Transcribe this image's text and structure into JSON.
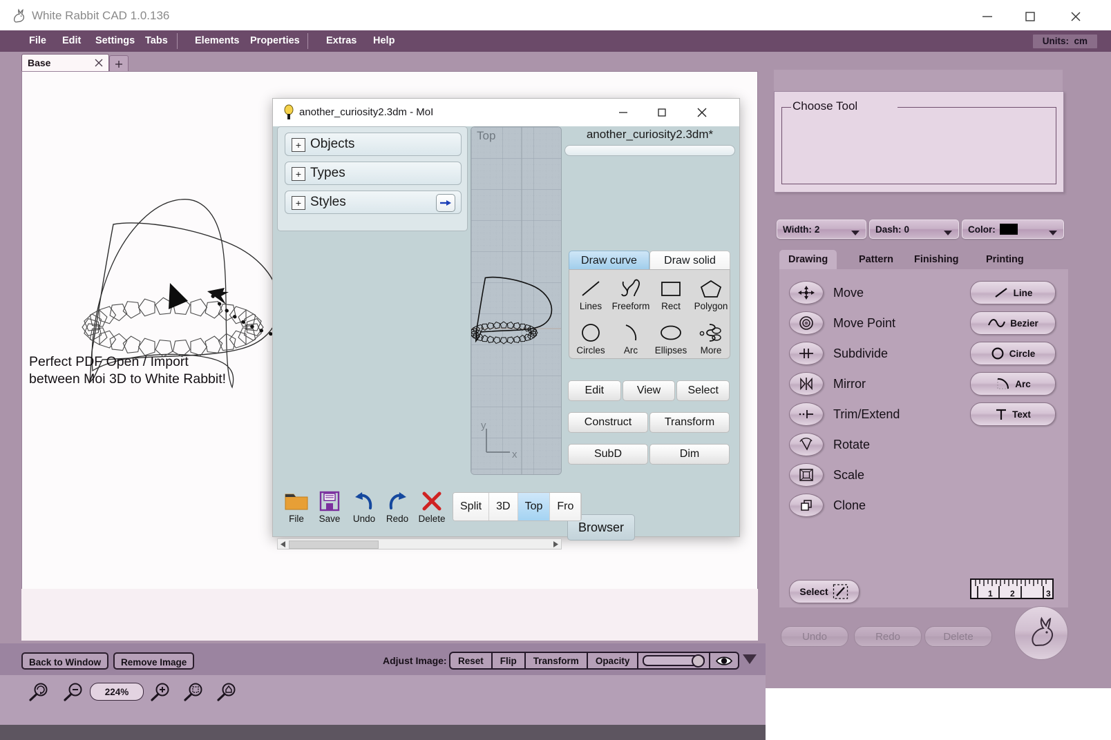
{
  "window": {
    "title": "White Rabbit CAD 1.0.136",
    "icon": "rabbit-icon",
    "minimize": "minimize-icon",
    "maximize": "maximize-icon",
    "close": "close-icon"
  },
  "menu": {
    "items": [
      "File",
      "Edit",
      "Settings",
      "Tabs",
      "Elements",
      "Properties",
      "Extras",
      "Help"
    ],
    "units_label": "Units:",
    "units_value": "cm"
  },
  "tabs": {
    "documents": [
      {
        "label": "Base",
        "close": "close-icon"
      }
    ],
    "add_label": "+"
  },
  "canvas": {
    "note_line1": "Perfect PDF Open / Import",
    "note_line2": "between Moi 3D to White Rabbit!"
  },
  "adjust_bar": {
    "back_to_window": "Back to Window",
    "remove_image": "Remove Image",
    "label": "Adjust Image:",
    "buttons": [
      "Reset",
      "Flip",
      "Transform",
      "Opacity"
    ],
    "opacity_value": 100,
    "eye_icon": "eye-icon",
    "expander_icon": "triangle-down-icon"
  },
  "zoom_bar": {
    "zoom_value": "224%",
    "icons": [
      "zoom-reset-icon",
      "zoom-out-icon",
      "zoom-in-icon",
      "zoom-to-selection-icon",
      "zoom-to-fit-icon"
    ]
  },
  "sidebar": {
    "choose_tool_legend": "Choose Tool",
    "controls": [
      {
        "name": "width",
        "label": "Width:",
        "value": "2"
      },
      {
        "name": "dash",
        "label": "Dash:",
        "value": "0"
      },
      {
        "name": "color",
        "label": "Color:",
        "value": "",
        "swatch": "#000000"
      }
    ],
    "tabs": [
      "Drawing",
      "Pattern",
      "Finishing",
      "Printing"
    ],
    "active_tab": "Drawing",
    "tools": [
      {
        "label": "Move",
        "icon": "move-icon"
      },
      {
        "label": "Move Point",
        "icon": "move-point-icon"
      },
      {
        "label": "Subdivide",
        "icon": "subdivide-icon"
      },
      {
        "label": "Mirror",
        "icon": "mirror-icon"
      },
      {
        "label": "Trim/Extend",
        "icon": "trim-extend-icon"
      },
      {
        "label": "Rotate",
        "icon": "rotate-icon"
      },
      {
        "label": "Scale",
        "icon": "scale-icon"
      },
      {
        "label": "Clone",
        "icon": "clone-icon"
      }
    ],
    "shapes": [
      {
        "label": "Line",
        "icon": "line-icon"
      },
      {
        "label": "Bezier",
        "icon": "bezier-icon"
      },
      {
        "label": "Circle",
        "icon": "circle-icon"
      },
      {
        "label": "Arc",
        "icon": "arc-icon"
      },
      {
        "label": "Text",
        "icon": "text-icon"
      }
    ],
    "select_label": "Select",
    "ruler_ticks": [
      "1",
      "2",
      "3"
    ],
    "footer_buttons": [
      "Undo",
      "Redo",
      "Delete"
    ],
    "rabbit_icon": "rabbit-logo-icon"
  },
  "moi_dialog": {
    "title": "another_curiosity2.3dm - MoI",
    "icon": "moi-icon",
    "minimize": "minimize-icon",
    "maximize": "maximize-icon",
    "close": "close-icon",
    "accordions": [
      {
        "label": "Objects",
        "expander": "+"
      },
      {
        "label": "Types",
        "expander": "+"
      },
      {
        "label": "Styles",
        "expander": "+",
        "arrow": "arrow-right-icon"
      }
    ],
    "viewport_label": "Top",
    "axis_x": "x",
    "axis_y": "y",
    "file_name": "another_curiosity2.3dm*",
    "draw_tabs": [
      "Draw curve",
      "Draw solid"
    ],
    "active_draw_tab": "Draw curve",
    "draw_tools": [
      {
        "label": "Lines",
        "icon": "line-icon"
      },
      {
        "label": "Freeform",
        "icon": "freeform-icon"
      },
      {
        "label": "Rect",
        "icon": "rect-icon"
      },
      {
        "label": "Polygon",
        "icon": "polygon-icon"
      },
      {
        "label": "Circles",
        "icon": "circle-icon"
      },
      {
        "label": "Arc",
        "icon": "arc-icon"
      },
      {
        "label": "Ellipses",
        "icon": "ellipse-icon"
      },
      {
        "label": "More",
        "icon": "more-curves-icon"
      }
    ],
    "menu_rows": [
      [
        "Edit",
        "View",
        "Select"
      ],
      [
        "Construct",
        "Transform"
      ],
      [
        "SubD",
        "Dim"
      ]
    ],
    "browser_label": "Browser",
    "bottom_icons": [
      {
        "label": "File",
        "icon": "folder-icon"
      },
      {
        "label": "Save",
        "icon": "floppy-icon"
      },
      {
        "label": "Undo",
        "icon": "undo-icon"
      },
      {
        "label": "Redo",
        "icon": "redo-icon"
      },
      {
        "label": "Delete",
        "icon": "delete-x-icon"
      }
    ],
    "view_buttons": [
      "Split",
      "3D",
      "Top",
      "Fro"
    ],
    "active_view": "Top"
  }
}
